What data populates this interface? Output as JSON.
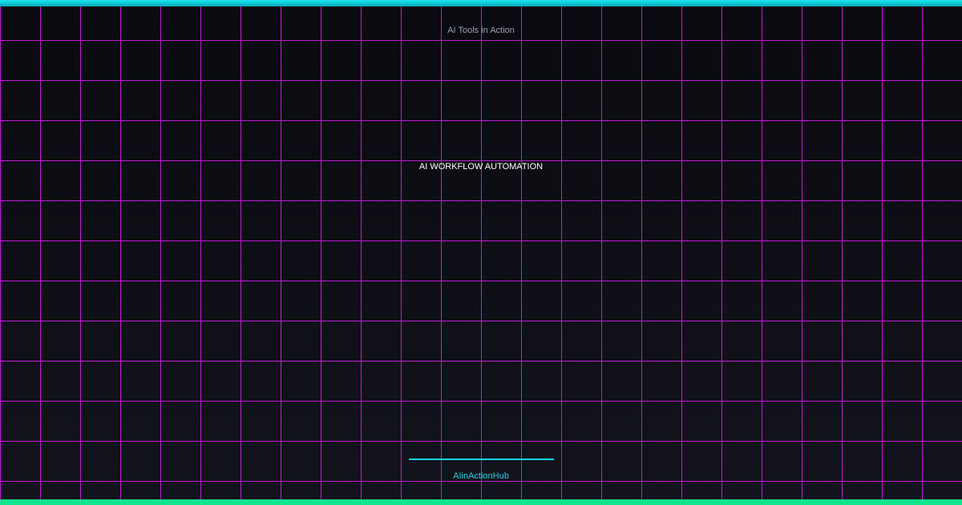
{
  "banner": {
    "subtitle": "AI Tools in Action",
    "headline": "AI WORKFLOW AUTOMATION",
    "brand": "AIinActionHub"
  },
  "colors": {
    "background": "#0c0c12",
    "grid": "#c21ad6",
    "top_bar": "#14d2e0",
    "bottom_bar": "#12e38d",
    "brand_text": "#20d2e8",
    "divider": "#18d4ea"
  }
}
